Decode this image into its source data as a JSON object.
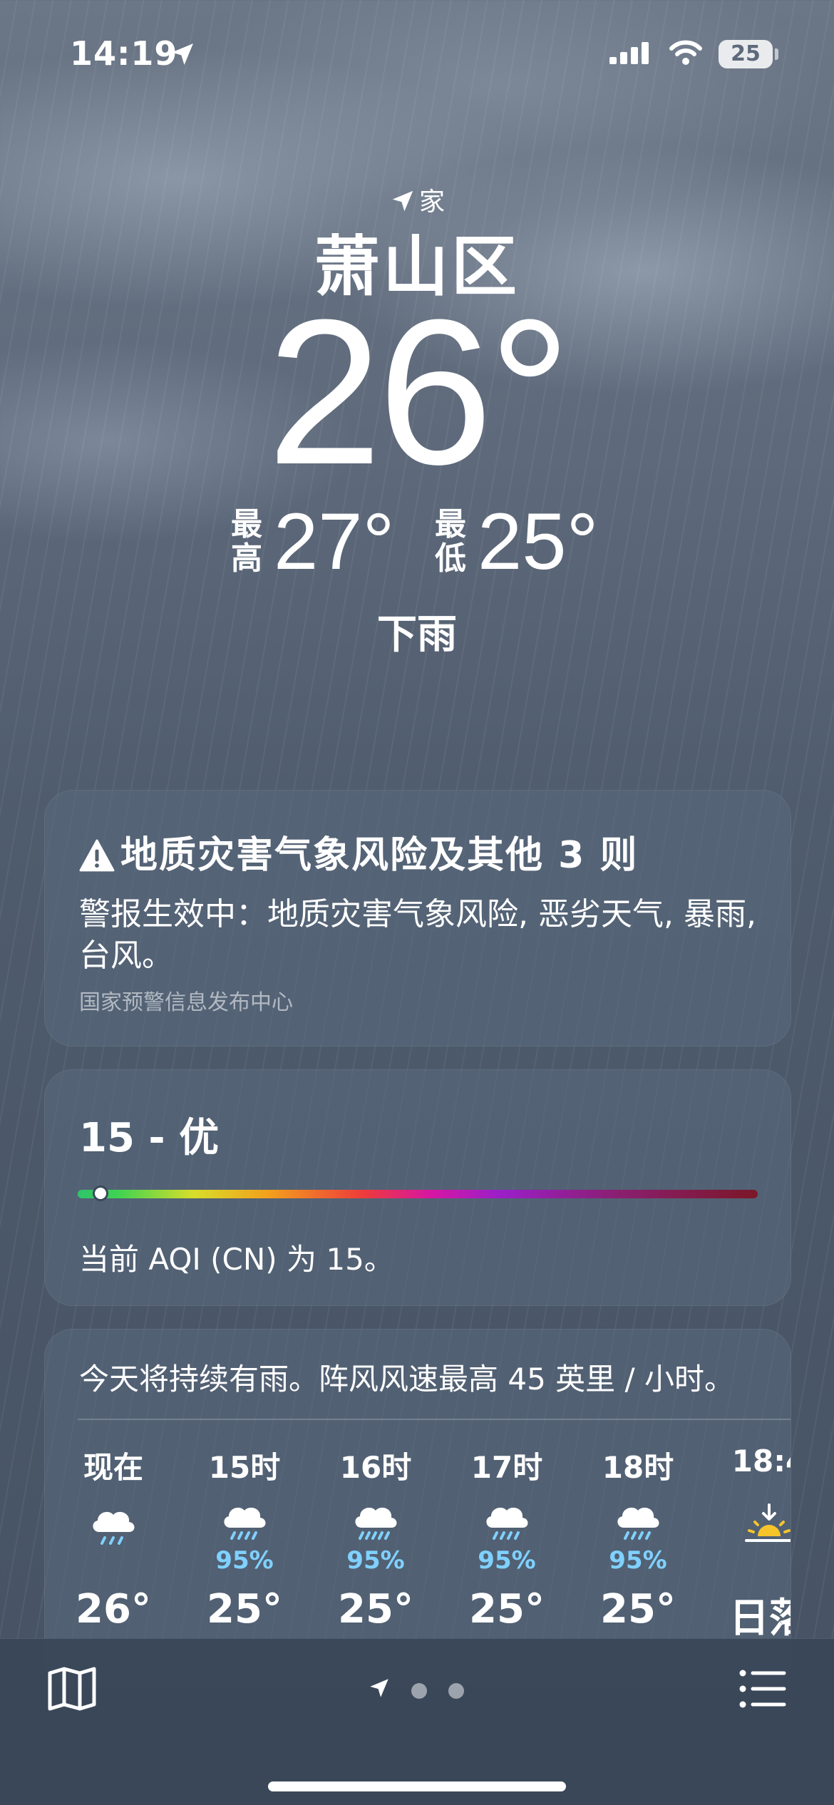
{
  "status_bar": {
    "time": "14:19",
    "battery": "25"
  },
  "location": {
    "label": "家",
    "city": "萧山区"
  },
  "current": {
    "temperature": "26°",
    "high_label": "最高",
    "high": "27°",
    "low_label": "最低",
    "low": "25°",
    "condition": "下雨"
  },
  "alert": {
    "title": "地质灾害气象风险及其他 3 则",
    "description": "警报生效中：地质灾害气象风险, 恶劣天气, 暴雨, 台风。",
    "source": "国家预警信息发布中心"
  },
  "aqi": {
    "value": "15 - 优",
    "level": 15,
    "scale_max": 500,
    "description": "当前 AQI (CN) 为 15。"
  },
  "hourly": {
    "summary": "今天将持续有雨。阵风风速最高 45 英里 / 小时。",
    "hours": [
      {
        "time": "现在",
        "icon": "cloud-rain-icon",
        "pop": "",
        "temp": "26°"
      },
      {
        "time": "15时",
        "icon": "cloud-heavy-rain-icon",
        "pop": "95%",
        "temp": "25°"
      },
      {
        "time": "16时",
        "icon": "cloud-heavy-rain-icon",
        "pop": "95%",
        "temp": "25°"
      },
      {
        "time": "17时",
        "icon": "cloud-heavy-rain-icon",
        "pop": "95%",
        "temp": "25°"
      },
      {
        "time": "18时",
        "icon": "cloud-heavy-rain-icon",
        "pop": "95%",
        "temp": "25°"
      },
      {
        "time": "18:4",
        "icon": "sunset-icon",
        "pop": "",
        "temp": "日落"
      }
    ]
  },
  "colors": {
    "precip_blue": "#7fd1ff",
    "sun_yellow": "#f7c52a"
  }
}
